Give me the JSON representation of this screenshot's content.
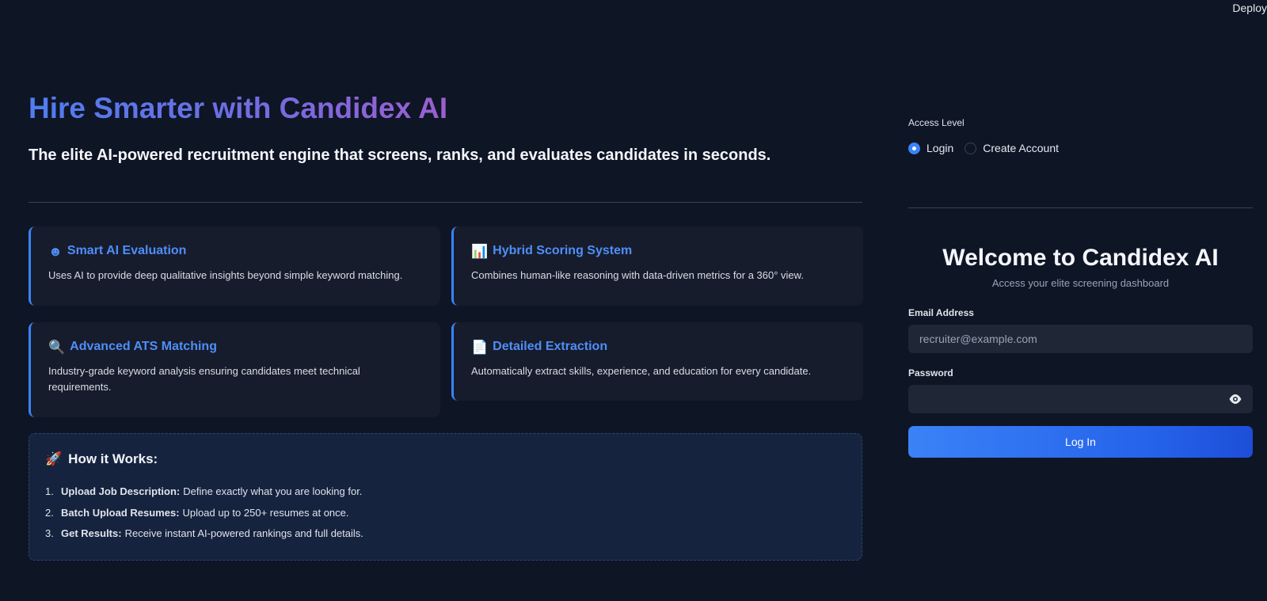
{
  "toolbar": {
    "deploy_label": "Deploy"
  },
  "hero": {
    "title": "Hire Smarter with Candidex AI",
    "subtitle": "The elite AI-powered recruitment engine that screens, ranks, and evaluates candidates in seconds."
  },
  "features": [
    {
      "icon": "☻",
      "icon_name": "robot-icon",
      "title": "Smart AI Evaluation",
      "desc": "Uses AI to provide deep qualitative insights beyond simple keyword matching."
    },
    {
      "icon": "📊",
      "icon_name": "bar-chart-icon",
      "title": "Hybrid Scoring System",
      "desc": "Combines human-like reasoning with data-driven metrics for a 360° view."
    },
    {
      "icon": "🔍",
      "icon_name": "magnifier-icon",
      "title": "Advanced ATS Matching",
      "desc": "Industry-grade keyword analysis ensuring candidates meet technical requirements."
    },
    {
      "icon": "📄",
      "icon_name": "document-icon",
      "title": "Detailed Extraction",
      "desc": "Automatically extract skills, experience, and education for every candidate."
    }
  ],
  "how_it_works": {
    "icon": "🚀",
    "title": "How it Works:",
    "steps": [
      {
        "num": "1.",
        "bold": "Upload Job Description:",
        "text": "Define exactly what you are looking for."
      },
      {
        "num": "2.",
        "bold": "Batch Upload Resumes:",
        "text": "Upload up to 250+ resumes at once."
      },
      {
        "num": "3.",
        "bold": "Get Results:",
        "text": "Receive instant AI-powered rankings and full details."
      }
    ]
  },
  "auth": {
    "access_label": "Access Level",
    "options": [
      {
        "label": "Login",
        "selected": true
      },
      {
        "label": "Create Account",
        "selected": false
      }
    ],
    "welcome_title": "Welcome to Candidex AI",
    "welcome_sub": "Access your elite screening dashboard",
    "email_label": "Email Address",
    "email_placeholder": "recruiter@example.com",
    "email_value": "",
    "password_label": "Password",
    "password_value": "",
    "submit_label": "Log In"
  },
  "colors": {
    "background": "#0e1525",
    "accent": "#3b82f6",
    "card": "#161c2c",
    "title_gradient": [
      "#4f7df0",
      "#9a5fcf"
    ]
  }
}
